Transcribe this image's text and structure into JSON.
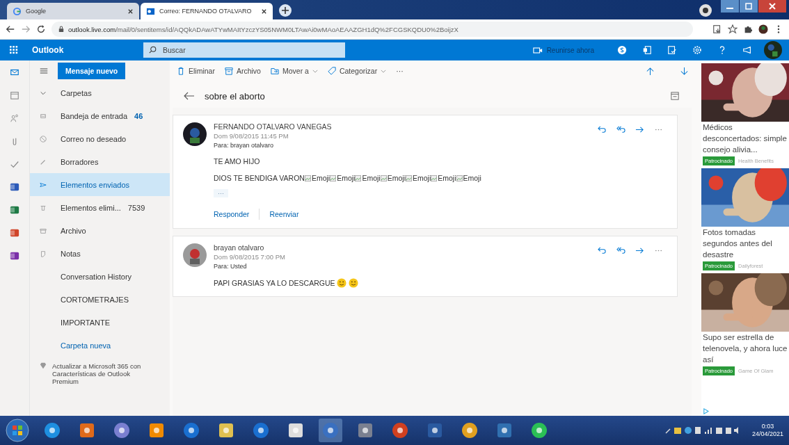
{
  "browser": {
    "tabs": [
      {
        "title": "Google",
        "selected": false
      },
      {
        "title": "Correo: FERNANDO OTALVARO",
        "selected": true
      }
    ],
    "url_host": "outlook.live.com",
    "url_path": "/mail/0/sentitems/id/AQQkADAwATYwMAItYzczYS05NWM0LTAwAi0wMAoAEAAZGH1dQ%2FCGSKQDU0%2BoijzX"
  },
  "header": {
    "app_name": "Outlook",
    "search_placeholder": "Buscar",
    "meet_now": "Reunirse ahora"
  },
  "toolbar": {
    "new_message": "Mensaje nuevo",
    "actions": [
      {
        "label": "Eliminar",
        "kind": "trash"
      },
      {
        "label": "Archivo",
        "kind": "archive"
      },
      {
        "label": "Mover a",
        "kind": "move",
        "dropdown": true
      },
      {
        "label": "Categorizar",
        "kind": "tag",
        "dropdown": true
      }
    ],
    "more": "···"
  },
  "folders": {
    "header": "Carpetas",
    "items": [
      {
        "name": "Bandeja de entrada",
        "count": "46",
        "kind": "inbox",
        "selected": false
      },
      {
        "name": "Correo no deseado",
        "kind": "junk",
        "selected": false
      },
      {
        "name": "Borradores",
        "kind": "draft",
        "selected": false
      },
      {
        "name": "Elementos enviados",
        "kind": "sent",
        "selected": true
      },
      {
        "name": "Elementos elimi...",
        "count": "7539",
        "kind": "trash",
        "selected": false
      },
      {
        "name": "Archivo",
        "kind": "archive",
        "selected": false
      },
      {
        "name": "Notas",
        "kind": "note",
        "selected": false
      },
      {
        "name": "Conversation History",
        "kind": "none",
        "selected": false
      },
      {
        "name": "CORTOMETRAJES",
        "kind": "none",
        "selected": false
      },
      {
        "name": "IMPORTANTE",
        "kind": "none",
        "selected": false
      }
    ],
    "new_folder": "Carpeta nueva",
    "upgrade": "Actualizar a Microsoft 365 con Características de Outlook Premium"
  },
  "conversation": {
    "subject": "sobre el aborto",
    "messages": [
      {
        "sender": "FERNANDO OTALVARO VANEGAS",
        "date": "Dom 9/08/2015 11:45 PM",
        "to_label": "Para:",
        "to": "brayan otalvaro",
        "lines": [
          "TE AMO HIJO",
          "DIOS TE BENDIGA VARON"
        ],
        "broken_images": [
          "Emoji",
          "Emoji",
          "Emoji",
          "Emoji",
          "Emoji",
          "Emoji",
          "Emoji"
        ],
        "emojis": false,
        "expand": "···",
        "actions": [
          "Responder",
          "Reenviar"
        ]
      },
      {
        "sender": "brayan otalvaro",
        "date": "Dom 9/08/2015 7:00 PM",
        "to_label": "Para:",
        "to": "Usted",
        "lines": [
          "PAPI GRASIAS YA LO DESCARGUE"
        ],
        "emojis": true
      }
    ]
  },
  "ads": [
    {
      "title": "Médicos desconcertados: simple consejo alivia...",
      "badge": "Patrocinado",
      "source": "Health Benefits",
      "kind": "picture"
    },
    {
      "title": "Fotos tomadas segundos antes del desastre",
      "badge": "Patrocinado",
      "source": "Dailyforest",
      "kind": "picture"
    },
    {
      "title": "Supo ser estrella de telenovela, y ahora luce así",
      "badge": "Patrocinado",
      "source": "Game Of Glam",
      "kind": "picture"
    }
  ],
  "taskbar": {
    "time": "0:03",
    "date": "24/04/2021"
  }
}
